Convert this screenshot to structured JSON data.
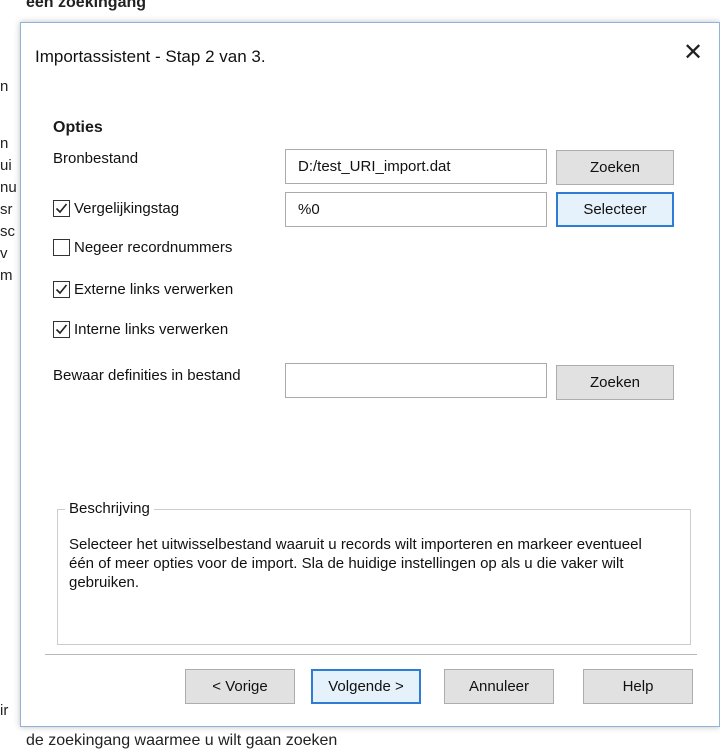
{
  "background": {
    "top_text": "een zoekingang",
    "bottom_text": "de zoekingang waarmee u wilt gaan zoeken",
    "left_letters": [
      "n",
      "n",
      "ui",
      "nu",
      "sr",
      "sc",
      "v",
      "m",
      "ir"
    ]
  },
  "dialog": {
    "title": "Importassistent - Stap 2 van 3.",
    "close_icon": "close-icon",
    "section_title": "Opties",
    "bronbestand": {
      "label": "Bronbestand",
      "value": "D:/test_URI_import.dat",
      "button": "Zoeken"
    },
    "vergelijkingstag": {
      "label": "Vergelijkingstag",
      "checked": true,
      "value": "%0",
      "button": "Selecteer"
    },
    "options": [
      {
        "label": "Negeer recordnummers",
        "checked": false
      },
      {
        "label": "Externe links verwerken",
        "checked": true
      },
      {
        "label": "Interne links verwerken",
        "checked": true
      }
    ],
    "bewaar": {
      "label": "Bewaar definities in bestand",
      "value": "",
      "button": "Zoeken"
    },
    "beschrijving": {
      "title": "Beschrijving",
      "text": "Selecteer het uitwisselbestand waaruit u records wilt importeren en markeer eventueel één of meer opties voor de import. Sla de huidige instellingen op als u die vaker wilt gebruiken."
    },
    "buttons": {
      "prev": "< Vorige",
      "next": "Volgende >",
      "cancel": "Annuleer",
      "help": "Help"
    }
  },
  "colors": {
    "accent": "#2f7bd6",
    "button_bg": "#e1e1e1",
    "dialog_border": "#8fb3d9"
  }
}
